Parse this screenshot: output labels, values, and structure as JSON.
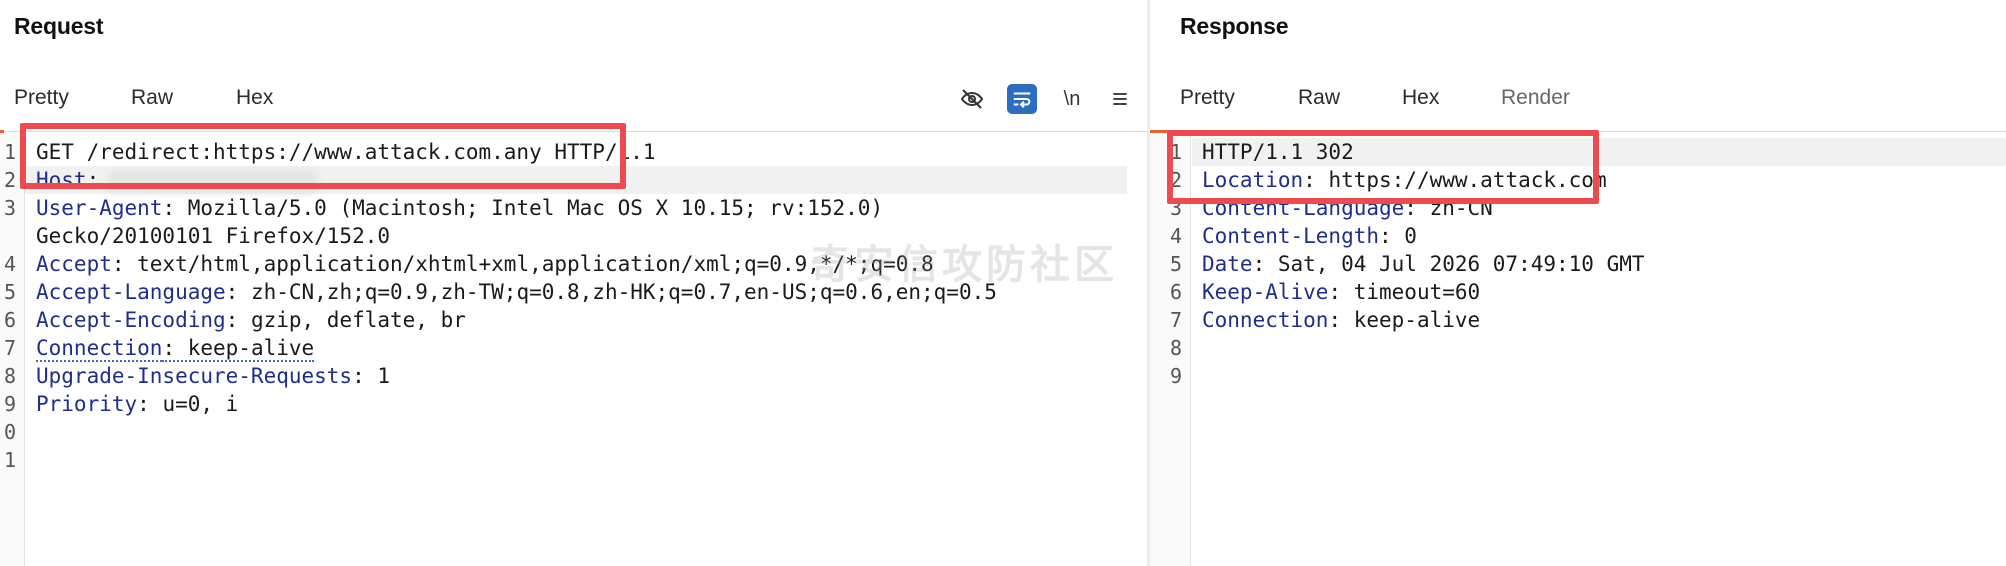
{
  "request": {
    "title": "Request",
    "tabs": [
      {
        "label": "Pretty",
        "active": true
      },
      {
        "label": "Raw"
      },
      {
        "label": "Hex"
      }
    ],
    "tools": {
      "hide_icon": "eye-off-icon",
      "wrap_icon": "wrap-lines-icon",
      "newline_label": "\\n",
      "menu_icon": "hamburger-menu-icon"
    },
    "line_numbers": [
      "1",
      "2",
      "3",
      "",
      "4",
      "5",
      "6",
      "7",
      "8",
      "9",
      "0",
      "1"
    ],
    "lines": [
      {
        "value": "GET /redirect:https://www.attack.com.any HTTP/1.1"
      },
      {
        "key": "Host",
        "value": ": "
      },
      {
        "key": "User-Agent",
        "value": ": Mozilla/5.0 (Macintosh; Intel Mac OS X 10.15; rv:152.0)"
      },
      {
        "value": "Gecko/20100101 Firefox/152.0"
      },
      {
        "key": "Accept",
        "value": ": text/html,application/xhtml+xml,application/xml;q=0.9,*/*;q=0.8"
      },
      {
        "key": "Accept-Language",
        "value": ": zh-CN,zh;q=0.9,zh-TW;q=0.8,zh-HK;q=0.7,en-US;q=0.6,en;q=0.5"
      },
      {
        "key": "Accept-Encoding",
        "value": ": gzip, deflate, br"
      },
      {
        "key": "Connection",
        "value": ": keep-alive"
      },
      {
        "key": "Upgrade-Insecure-Requests",
        "value": ": 1"
      },
      {
        "key": "Priority",
        "value": ": u=0, i"
      }
    ]
  },
  "response": {
    "title": "Response",
    "tabs": [
      {
        "label": "Pretty",
        "active": true
      },
      {
        "label": "Raw"
      },
      {
        "label": "Hex"
      },
      {
        "label": "Render"
      }
    ],
    "line_numbers": [
      "1",
      "2",
      "3",
      "4",
      "5",
      "6",
      "7",
      "8",
      "9"
    ],
    "lines": [
      {
        "value": "HTTP/1.1 302"
      },
      {
        "key": "Location",
        "value": ": https://www.attack.com"
      },
      {
        "key": "Content-Language",
        "value": ": zh-CN"
      },
      {
        "key": "Content-Length",
        "value": ": 0"
      },
      {
        "key": "Date",
        "value": ": Sat, 04 Jul 2026 07:49:10 GMT"
      },
      {
        "key": "Keep-Alive",
        "value": ": timeout=60"
      },
      {
        "key": "Connection",
        "value": ": keep-alive"
      }
    ]
  },
  "watermark": "奇安信攻防社区",
  "colors": {
    "accent": "#e8622a",
    "highlight_box": "#ef4a4f",
    "header_key": "#1d2f8a",
    "tool_active": "#2b6dbf"
  }
}
